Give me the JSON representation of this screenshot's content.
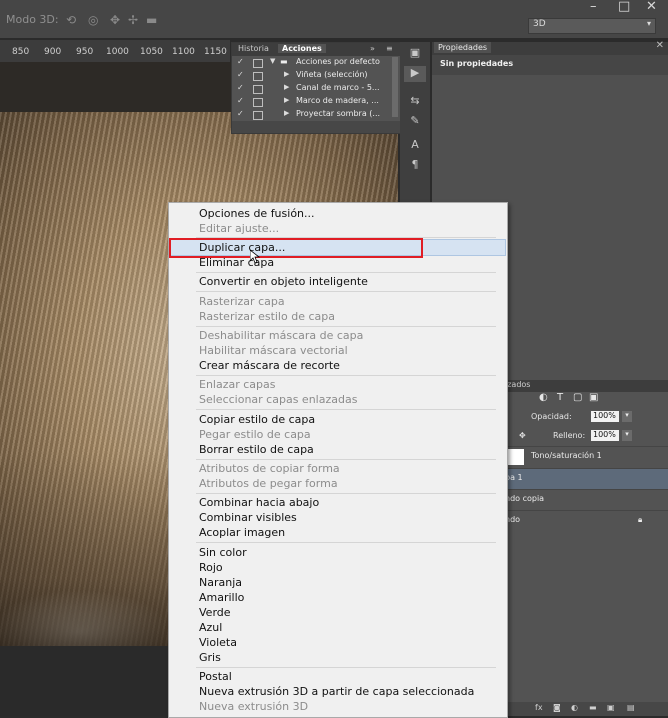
{
  "options_bar": {
    "mode3d_label": "Modo 3D:",
    "workspace_select": "3D",
    "minimize": "–",
    "maximize": "□",
    "close": "✕"
  },
  "ruler": {
    "ticks": [
      "850",
      "900",
      "950",
      "1000",
      "1050",
      "1100",
      "1150"
    ]
  },
  "history_panel": {
    "tabs": [
      "Historia",
      "Acciones"
    ],
    "actions": [
      {
        "label": "Acciones por defecto",
        "checked": true
      },
      {
        "label": "Viñeta (selección)",
        "checked": true
      },
      {
        "label": "Canal de marco - 5...",
        "checked": true
      },
      {
        "label": "Marco de madera, ...",
        "checked": true
      },
      {
        "label": "Proyectar sombra (...",
        "checked": true
      }
    ]
  },
  "properties_panel": {
    "tab": "Propiedades",
    "content": "Sin propiedades",
    "close": "✕"
  },
  "layers_panel": {
    "header_partial": "izados",
    "opacity_label": "Opacidad:",
    "opacity_value": "100%",
    "fill_label": "Relleno:",
    "fill_value": "100%",
    "layers": [
      {
        "name": "Tono/saturación 1"
      },
      {
        "name": "pa 1"
      },
      {
        "name": "ndo copia"
      },
      {
        "name": "ndo"
      }
    ],
    "footer_fx": "fx"
  },
  "context_menu": {
    "items": [
      {
        "label": "Opciones de fusión...",
        "enabled": true
      },
      {
        "label": "Editar ajuste...",
        "enabled": false
      },
      {
        "label": "Duplicar capa...",
        "enabled": true,
        "highlighted": true
      },
      {
        "label": "Eliminar capa",
        "enabled": true
      },
      {
        "label": "Convertir en objeto inteligente",
        "enabled": true
      },
      {
        "label": "Rasterizar capa",
        "enabled": false
      },
      {
        "label": "Rasterizar estilo de capa",
        "enabled": false
      },
      {
        "label": "Deshabilitar máscara de capa",
        "enabled": false
      },
      {
        "label": "Habilitar máscara vectorial",
        "enabled": false
      },
      {
        "label": "Crear máscara de recorte",
        "enabled": true
      },
      {
        "label": "Enlazar capas",
        "enabled": false
      },
      {
        "label": "Seleccionar capas enlazadas",
        "enabled": false
      },
      {
        "label": "Copiar estilo de capa",
        "enabled": true
      },
      {
        "label": "Pegar estilo de capa",
        "enabled": false
      },
      {
        "label": "Borrar estilo de capa",
        "enabled": true
      },
      {
        "label": "Atributos de copiar forma",
        "enabled": false
      },
      {
        "label": "Atributos de pegar forma",
        "enabled": false
      },
      {
        "label": "Combinar hacia abajo",
        "enabled": true
      },
      {
        "label": "Combinar visibles",
        "enabled": true
      },
      {
        "label": "Acoplar imagen",
        "enabled": true
      },
      {
        "label": "Sin color",
        "enabled": true
      },
      {
        "label": "Rojo",
        "enabled": true
      },
      {
        "label": "Naranja",
        "enabled": true
      },
      {
        "label": "Amarillo",
        "enabled": true
      },
      {
        "label": "Verde",
        "enabled": true
      },
      {
        "label": "Azul",
        "enabled": true
      },
      {
        "label": "Violeta",
        "enabled": true
      },
      {
        "label": "Gris",
        "enabled": true
      },
      {
        "label": "Postal",
        "enabled": true
      },
      {
        "label": "Nueva extrusión 3D a partir de capa seleccionada",
        "enabled": true
      },
      {
        "label": "Nueva extrusión 3D",
        "enabled": false
      }
    ]
  },
  "colors": {
    "highlight_outline": "#e01d24",
    "menu_bg": "#f0f0f0",
    "panel_bg": "#535353"
  }
}
